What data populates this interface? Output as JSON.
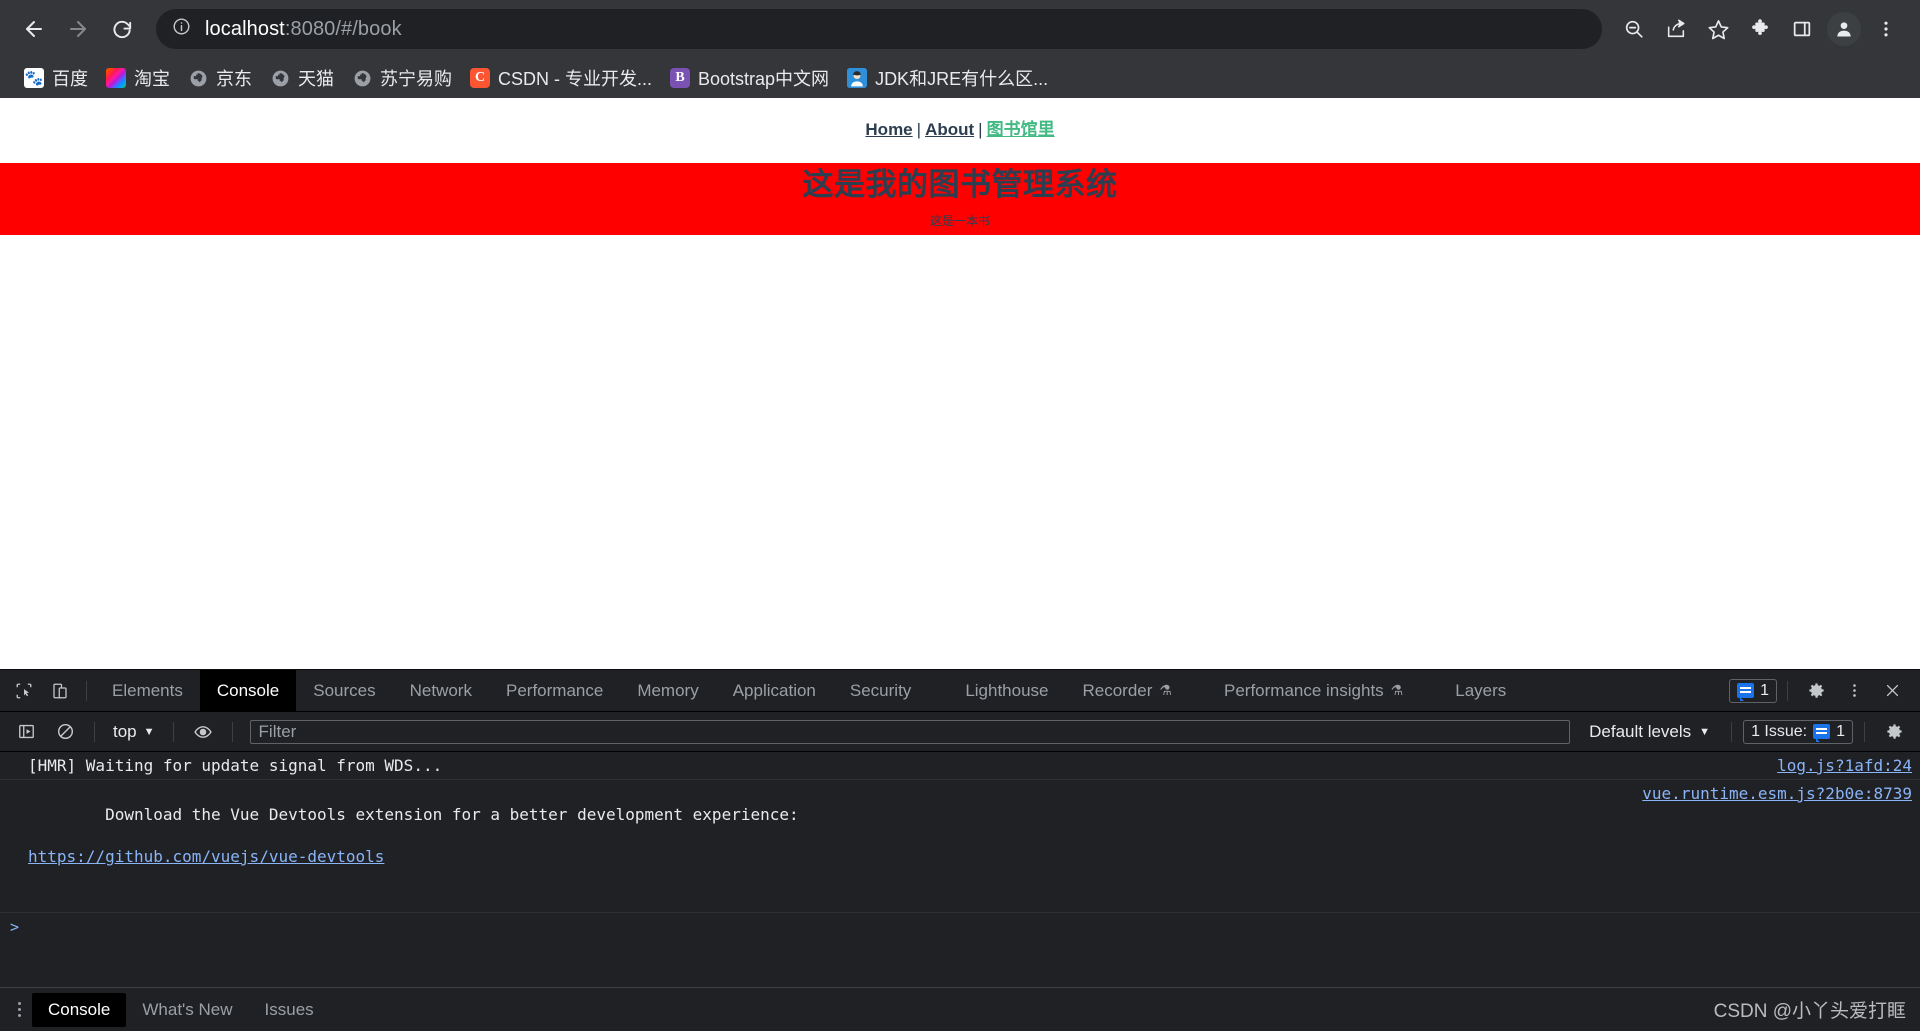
{
  "browser": {
    "nav": {
      "back_title": "Back",
      "forward_title": "Forward",
      "reload_title": "Reload"
    },
    "omnibox": {
      "host": "localhost",
      "path": ":8080/#/book",
      "full_url": "localhost:8080/#/book"
    },
    "toolbar_icons": [
      "zoom-out-icon",
      "share-icon",
      "bookmark-star-icon",
      "extensions-puzzle-icon",
      "side-panel-icon",
      "profile-avatar-icon",
      "chrome-menu-icon"
    ],
    "bookmarks": [
      {
        "label": "百度",
        "icon": "baidu-icon"
      },
      {
        "label": "淘宝",
        "icon": "taobao-icon"
      },
      {
        "label": "京东",
        "icon": "globe-icon"
      },
      {
        "label": "天猫",
        "icon": "globe-icon"
      },
      {
        "label": "苏宁易购",
        "icon": "globe-icon"
      },
      {
        "label": "CSDN - 专业开发...",
        "icon": "csdn-icon",
        "glyph": "C"
      },
      {
        "label": "Bootstrap中文网",
        "icon": "bootstrap-icon",
        "glyph": "B"
      },
      {
        "label": "JDK和JRE有什么区...",
        "icon": "jdk-icon"
      }
    ]
  },
  "page": {
    "nav": {
      "home": "Home",
      "about": "About",
      "library": "图书馆里",
      "separator": "|"
    },
    "banner": {
      "title": "这是我的图书管理系统",
      "subtitle": "这是一本书",
      "background_color": "#ff0000",
      "text_color": "#2c3e50"
    }
  },
  "devtools": {
    "tabs": [
      {
        "label": "Elements",
        "active": false
      },
      {
        "label": "Console",
        "active": true
      },
      {
        "label": "Sources",
        "active": false
      },
      {
        "label": "Network",
        "active": false
      },
      {
        "label": "Performance",
        "active": false
      },
      {
        "label": "Memory",
        "active": false
      },
      {
        "label": "Application",
        "active": false
      },
      {
        "label": "Security",
        "active": false
      },
      {
        "label": "Lighthouse",
        "active": false
      },
      {
        "label": "Recorder",
        "active": false,
        "flask": true
      },
      {
        "label": "Performance insights",
        "active": false,
        "flask": true
      },
      {
        "label": "Layers",
        "active": false
      }
    ],
    "tabbar_right": {
      "message_count": "1",
      "settings_icon": "gear-icon",
      "more_icon": "kebab-menu-icon",
      "close_icon": "close-icon"
    },
    "console_toolbar": {
      "context": "top",
      "filter_placeholder": "Filter",
      "filter_value": "",
      "levels": "Default levels",
      "issues_label": "1 Issue:",
      "issues_count": "1",
      "settings_icon": "gear-icon",
      "sidebar_icon": "console-sidebar-icon",
      "clear_icon": "clear-console-icon",
      "eye_icon": "live-expression-eye-icon"
    },
    "console_messages": [
      {
        "text": "[HMR] Waiting for update signal from WDS...",
        "link": "",
        "source": "log.js?1afd:24"
      },
      {
        "text": "Download the Vue Devtools extension for a better development experience:",
        "link": "https://github.com/vuejs/vue-devtools",
        "source": "vue.runtime.esm.js?2b0e:8739"
      }
    ],
    "prompt_symbol": ">",
    "drawer_tabs": [
      {
        "label": "Console",
        "active": true
      },
      {
        "label": "What's New",
        "active": false
      },
      {
        "label": "Issues",
        "active": false
      }
    ],
    "watermark": "CSDN @小丫头爱打眶"
  }
}
